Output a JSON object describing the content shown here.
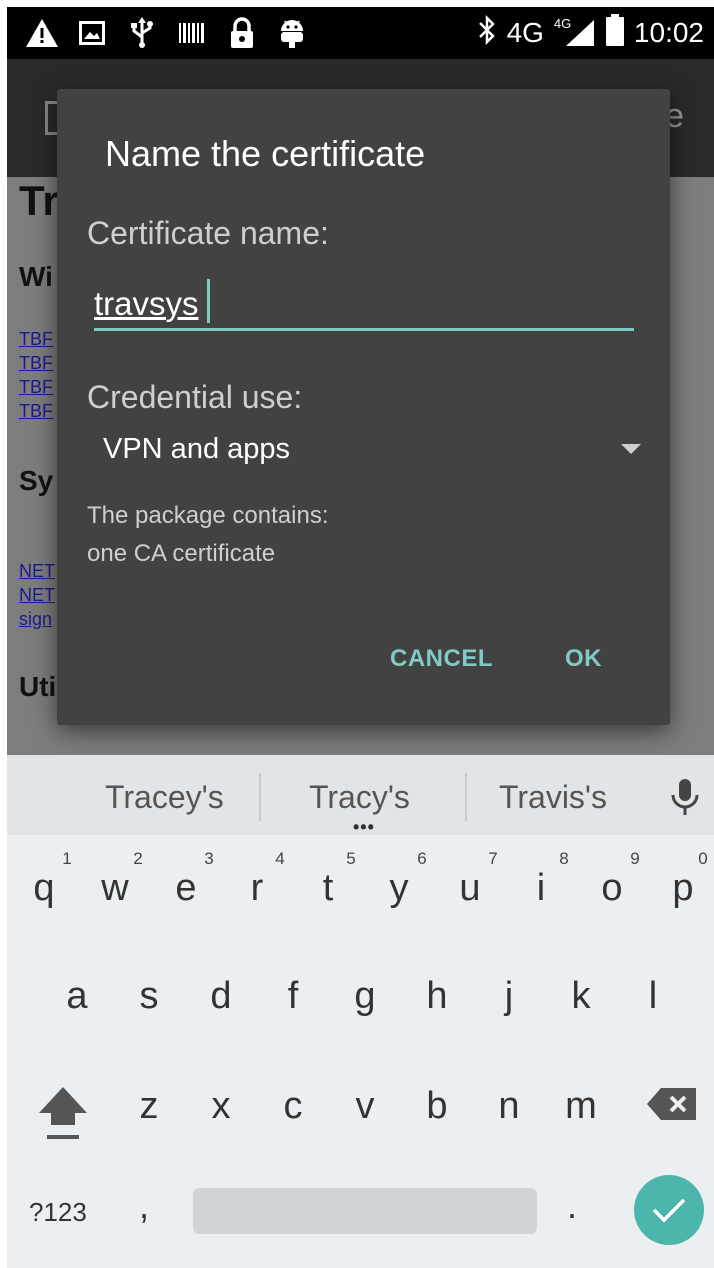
{
  "status_bar": {
    "left_icons": [
      "warning-icon",
      "image-icon",
      "usb-icon",
      "barcode-icon",
      "lock-icon",
      "android-icon"
    ],
    "network": "4G",
    "network_small": "4G",
    "time": "10:02"
  },
  "background_page": {
    "heading": "Tr",
    "section1": "Wi",
    "links1": [
      "TBF",
      "TBF",
      "TBF",
      "TBF"
    ],
    "section2": "Sy",
    "links2": [
      "NET",
      "NET",
      "sign"
    ],
    "section3": "Uti",
    "appbar_right": "e"
  },
  "dialog": {
    "title": "Name the certificate",
    "name_label": "Certificate name:",
    "name_value": "travsys",
    "use_label": "Credential use:",
    "use_value": "VPN and apps",
    "info_line1": "The package contains:",
    "info_line2": "one CA certificate",
    "cancel": "CANCEL",
    "ok": "OK",
    "accent_color": "#80cbc4"
  },
  "keyboard": {
    "suggestions": [
      "Tracey's",
      "Tracy's",
      "Travis's"
    ],
    "more": "•••",
    "row1": [
      "q",
      "w",
      "e",
      "r",
      "t",
      "y",
      "u",
      "i",
      "o",
      "p"
    ],
    "row1_hints": [
      "1",
      "2",
      "3",
      "4",
      "5",
      "6",
      "7",
      "8",
      "9",
      "0"
    ],
    "row2": [
      "a",
      "s",
      "d",
      "f",
      "g",
      "h",
      "j",
      "k",
      "l"
    ],
    "row3": [
      "z",
      "x",
      "c",
      "v",
      "b",
      "n",
      "m"
    ],
    "symbols_key": "?123",
    "comma": ",",
    "period": ".",
    "enter_color": "#4db6ac"
  }
}
